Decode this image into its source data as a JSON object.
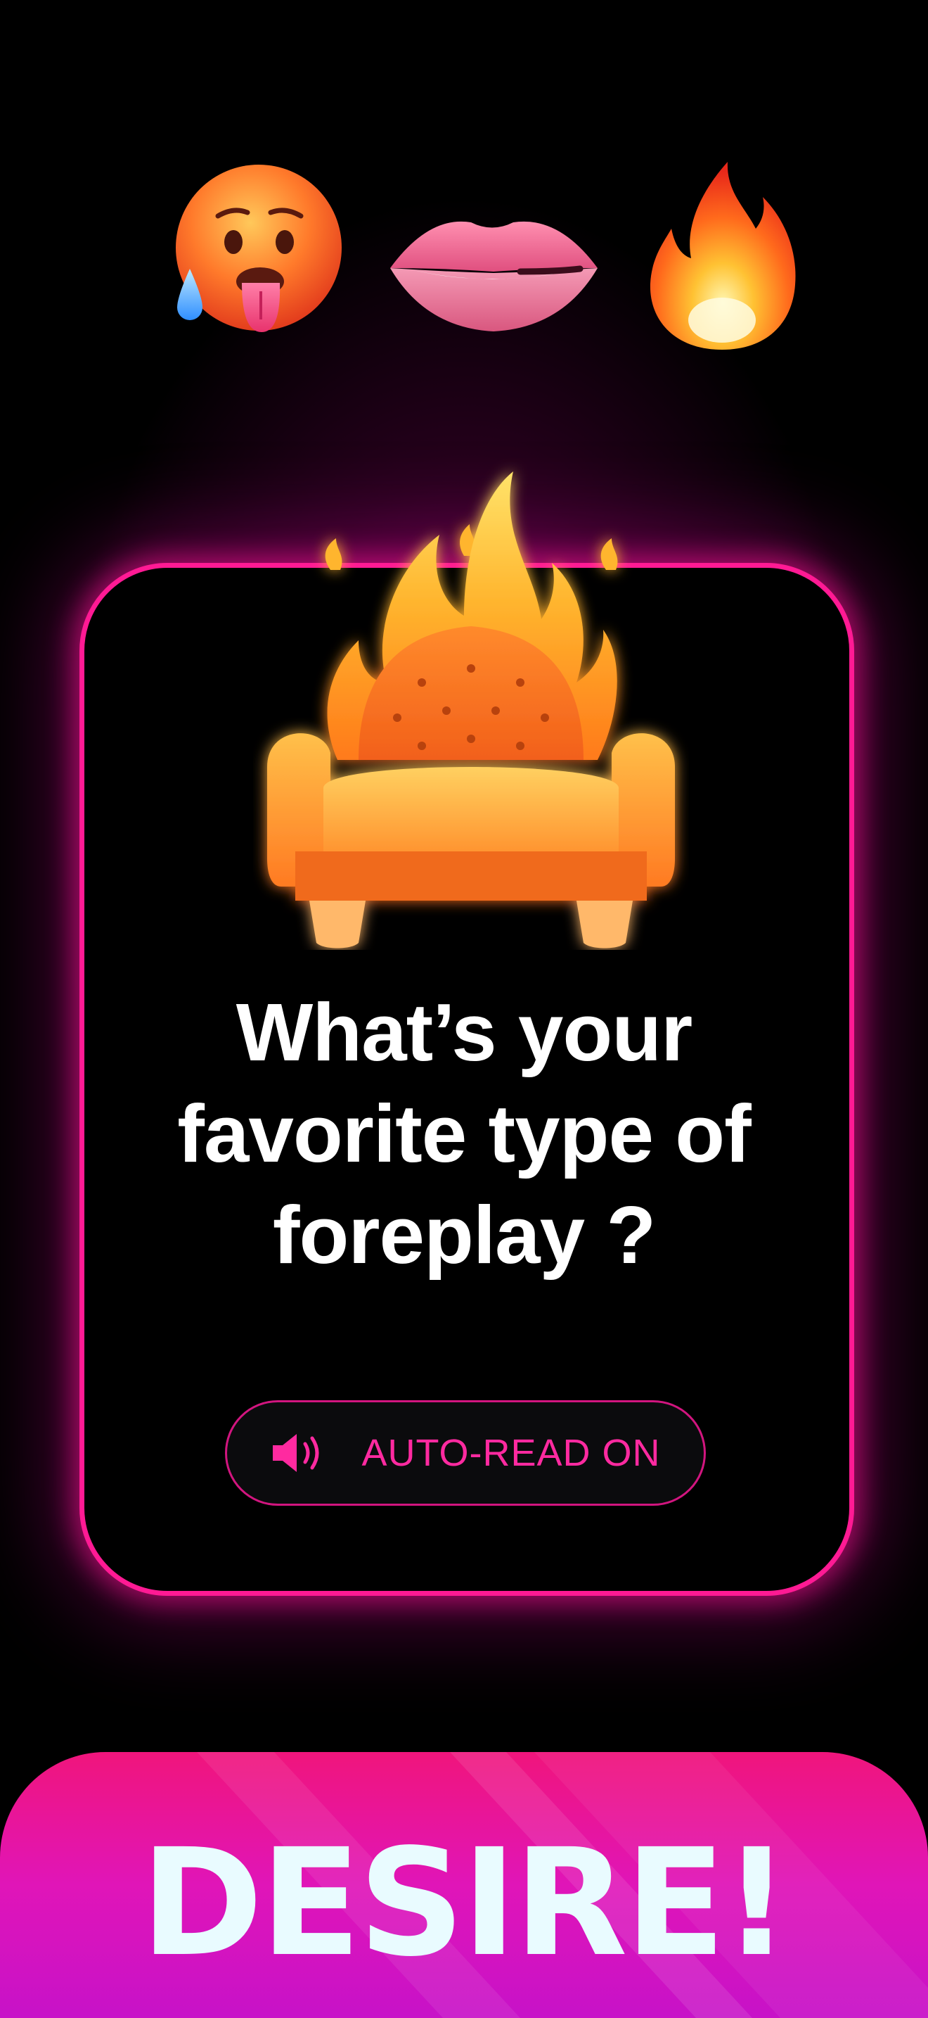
{
  "top_emojis": [
    "hot-face-icon",
    "lips-biting-icon",
    "fire-icon"
  ],
  "card": {
    "image_icon": "flaming-armchair-icon",
    "question": "What’s your favorite type of foreplay ?",
    "auto_read": {
      "icon": "speaker-icon",
      "label": "AUTO-READ ON"
    }
  },
  "banner": {
    "title": "DESIRE!"
  },
  "colors": {
    "accent_pink": "#ff1a94",
    "banner_start": "#f0157c",
    "banner_end": "#c712c8",
    "banner_text": "#e9fbff"
  }
}
